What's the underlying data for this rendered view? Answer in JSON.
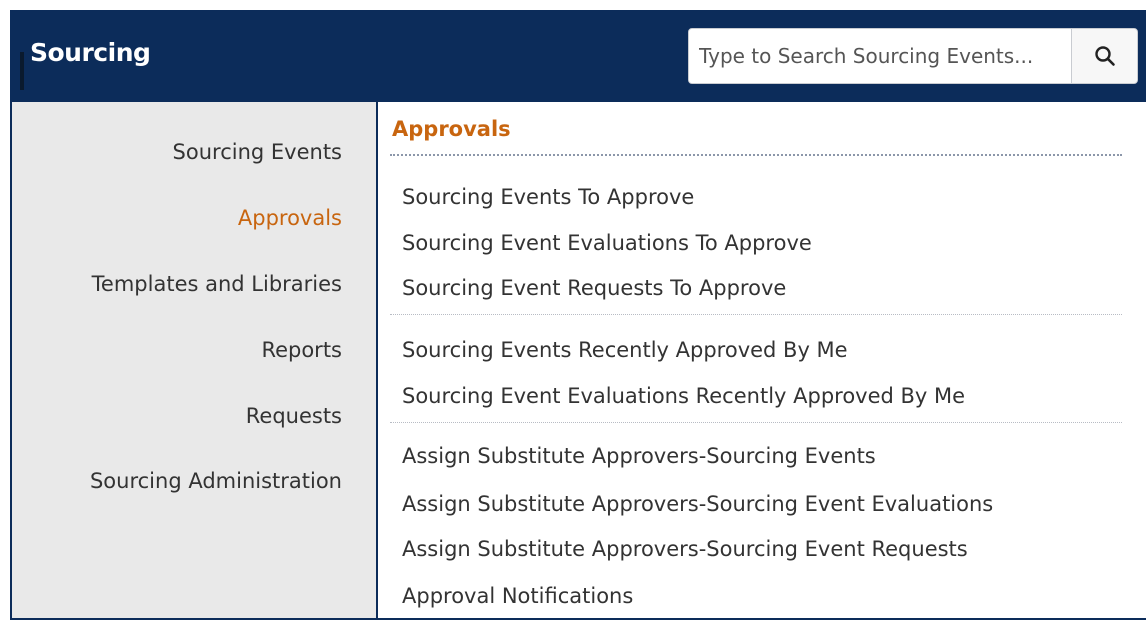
{
  "header": {
    "title": "Sourcing"
  },
  "search": {
    "placeholder": "Type to Search Sourcing Events...",
    "value": "",
    "button_icon": "search-icon"
  },
  "sidebar": {
    "items": [
      {
        "label": "Sourcing Events",
        "active": false
      },
      {
        "label": "Approvals",
        "active": true
      },
      {
        "label": "Templates and Libraries",
        "active": false
      },
      {
        "label": "Reports",
        "active": false
      },
      {
        "label": "Requests",
        "active": false
      },
      {
        "label": "Sourcing Administration",
        "active": false
      }
    ]
  },
  "content": {
    "section_title": "Approvals",
    "groups": [
      {
        "links": [
          "Sourcing Events To Approve",
          "Sourcing Event Evaluations To Approve",
          "Sourcing Event Requests To Approve"
        ]
      },
      {
        "links": [
          "Sourcing Events Recently Approved By Me",
          "Sourcing Event Evaluations Recently Approved By Me"
        ]
      },
      {
        "links": [
          "Assign Substitute Approvers-Sourcing Events",
          "Assign Substitute Approvers-Sourcing Event Evaluations",
          "Assign Substitute Approvers-Sourcing Event Requests",
          "Approval Notifications"
        ]
      }
    ]
  },
  "colors": {
    "header_bg": "#0c2c5a",
    "accent": "#c8650f",
    "sidebar_bg": "#e9e9e9",
    "text": "#333333"
  }
}
